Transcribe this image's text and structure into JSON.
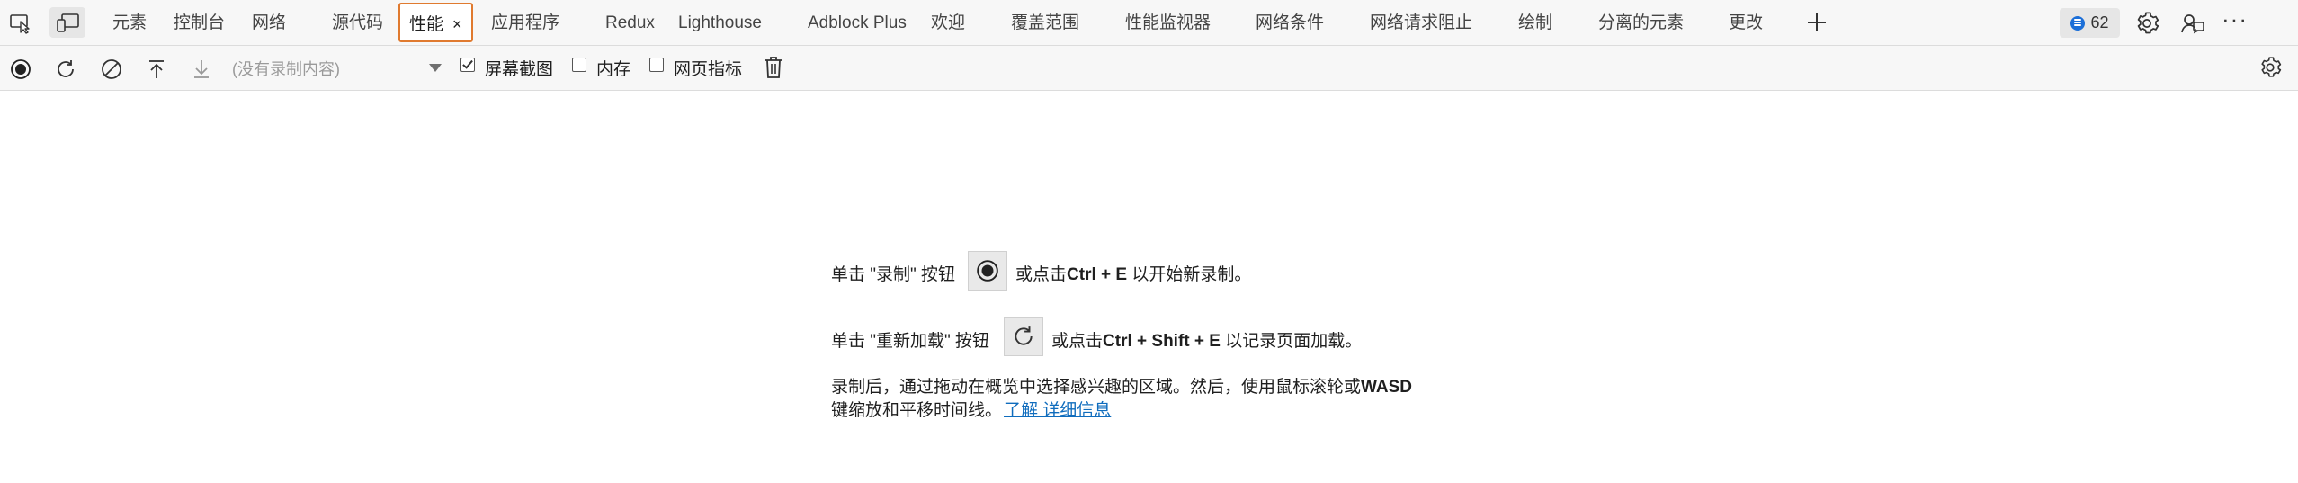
{
  "tabs": {
    "items": [
      {
        "label": "元素"
      },
      {
        "label": "控制台"
      },
      {
        "label": "网络"
      },
      {
        "label": "源代码"
      },
      {
        "label": "性能",
        "active": true
      },
      {
        "label": "应用程序"
      },
      {
        "label": "Redux"
      },
      {
        "label": "Lighthouse"
      },
      {
        "label": "Adblock Plus"
      },
      {
        "label": "欢迎"
      },
      {
        "label": "覆盖范围"
      },
      {
        "label": "性能监视器"
      },
      {
        "label": "网络条件"
      },
      {
        "label": "网络请求阻止"
      },
      {
        "label": "绘制"
      },
      {
        "label": "分离的元素"
      },
      {
        "label": "更改"
      }
    ],
    "close_glyph": "×",
    "add_glyph": "+",
    "issues_count": "62",
    "more_glyph": "···"
  },
  "toolbar": {
    "recording_select_placeholder": "(没有录制内容)",
    "checkboxes": [
      {
        "label": "屏幕截图",
        "checked": true
      },
      {
        "label": "内存",
        "checked": false
      },
      {
        "label": "网页指标",
        "checked": false
      }
    ]
  },
  "main": {
    "line1_prefix": "单击 \"录制\" 按钮",
    "line1_middle": "或点击",
    "line1_shortcut": "Ctrl + E",
    "line1_suffix": "以开始新录制。",
    "line2_prefix": "单击 \"重新加载\" 按钮",
    "line2_middle": "或点击",
    "line2_shortcut": "Ctrl + Shift + E",
    "line2_suffix": "以记录页面加载。",
    "line3_text": "录制后，通过拖动在概览中选择感兴趣的区域。然后，使用鼠标滚轮或",
    "line3_bold": "WASD",
    "line4_text": "键缩放和平移时间线。",
    "learn_more_link": "了解 详细信息"
  },
  "colors": {
    "active_tab_border": "#e07a2f",
    "link": "#0f6cbd",
    "badge_icon": "#1c6fd8"
  }
}
